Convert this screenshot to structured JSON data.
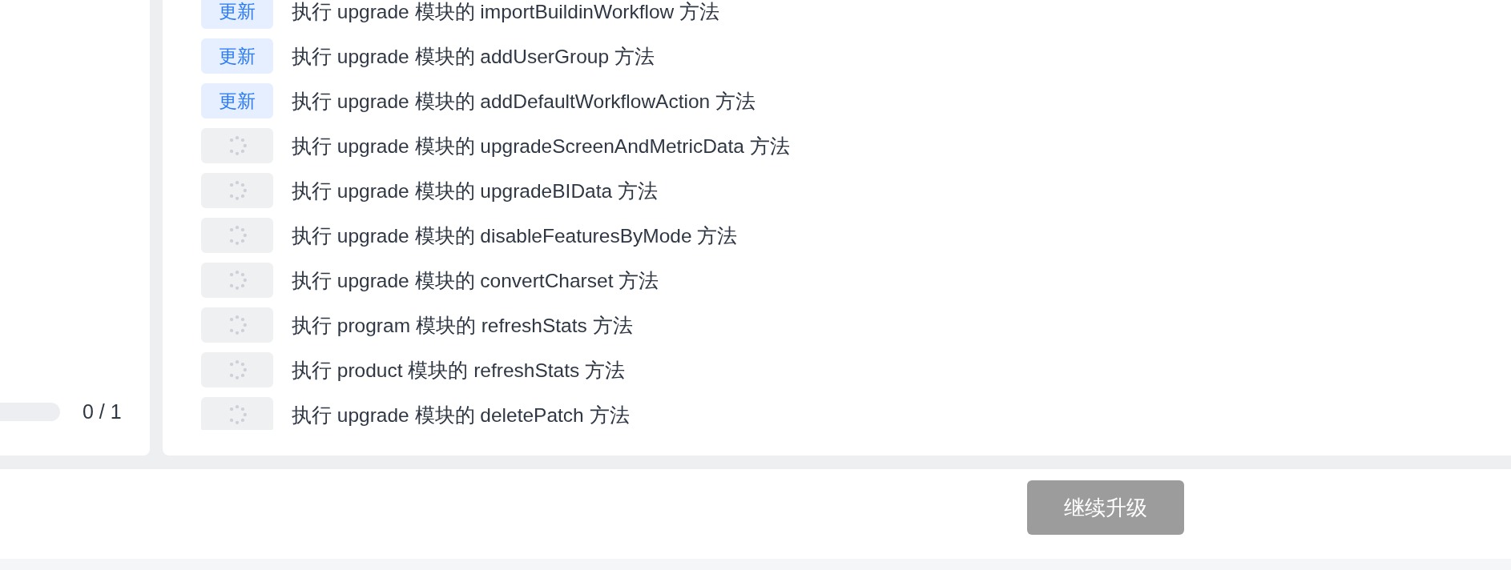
{
  "progress": {
    "level": 0,
    "reading": "0 / 1"
  },
  "steps": [
    {
      "kind": "done",
      "tag": "更新",
      "text": "执行 upgrade 模块的 importBuildinWorkflow 方法"
    },
    {
      "kind": "done",
      "tag": "更新",
      "text": "执行 upgrade 模块的 addUserGroup 方法"
    },
    {
      "kind": "done",
      "tag": "更新",
      "text": "执行 upgrade 模块的 addDefaultWorkflowAction 方法"
    },
    {
      "kind": "pending",
      "text": "执行 upgrade 模块的 upgradeScreenAndMetricData 方法"
    },
    {
      "kind": "pending",
      "text": "执行 upgrade 模块的 upgradeBIData 方法"
    },
    {
      "kind": "pending",
      "text": "执行 upgrade 模块的 disableFeaturesByMode 方法"
    },
    {
      "kind": "pending",
      "text": "执行 upgrade 模块的 convertCharset 方法"
    },
    {
      "kind": "pending",
      "text": "执行 program 模块的 refreshStats 方法"
    },
    {
      "kind": "pending",
      "text": "执行 product 模块的 refreshStats 方法"
    },
    {
      "kind": "pending",
      "text": "执行 upgrade 模块的 deletePatch 方法"
    }
  ],
  "footer": {
    "button": {
      "label": "继续升级",
      "disabled": true
    }
  }
}
